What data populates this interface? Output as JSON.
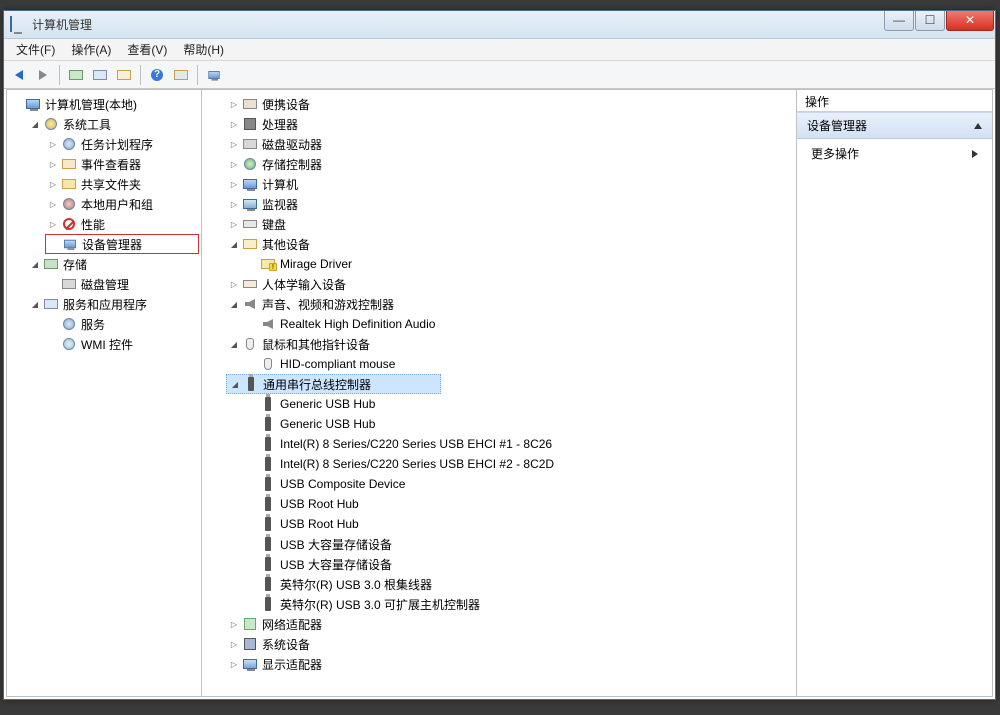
{
  "titlebar": {
    "title": "计算机管理"
  },
  "menu": {
    "file": "文件(F)",
    "action": "操作(A)",
    "view": "查看(V)",
    "help": "帮助(H)"
  },
  "left_tree": {
    "root": "计算机管理(本地)",
    "systools": "系统工具",
    "systools_items": [
      "任务计划程序",
      "事件查看器",
      "共享文件夹",
      "本地用户和组",
      "性能",
      "设备管理器"
    ],
    "storage": "存储",
    "storage_items": [
      "磁盘管理"
    ],
    "services": "服务和应用程序",
    "services_items": [
      "服务",
      "WMI 控件"
    ]
  },
  "mid_tree": {
    "portable": "便携设备",
    "cpu": "处理器",
    "diskdrive": "磁盘驱动器",
    "storagectl": "存储控制器",
    "computer": "计算机",
    "monitor": "监视器",
    "keyboard": "键盘",
    "other": "其他设备",
    "other_items": [
      "Mirage Driver"
    ],
    "hid": "人体学输入设备",
    "sound": "声音、视频和游戏控制器",
    "sound_items": [
      "Realtek High Definition Audio"
    ],
    "mouse": "鼠标和其他指针设备",
    "mouse_items": [
      "HID-compliant mouse"
    ],
    "usb": "通用串行总线控制器",
    "usb_items": [
      "Generic USB Hub",
      "Generic USB Hub",
      "Intel(R) 8 Series/C220 Series USB EHCI #1 - 8C26",
      "Intel(R) 8 Series/C220 Series USB EHCI #2 - 8C2D",
      "USB Composite Device",
      "USB Root Hub",
      "USB Root Hub",
      "USB 大容量存储设备",
      "USB 大容量存储设备",
      "英特尔(R) USB 3.0 根集线器",
      "英特尔(R) USB 3.0 可扩展主机控制器"
    ],
    "network": "网络适配器",
    "sysdev": "系统设备",
    "display": "显示适配器"
  },
  "right": {
    "header": "操作",
    "selected": "设备管理器",
    "more": "更多操作"
  }
}
